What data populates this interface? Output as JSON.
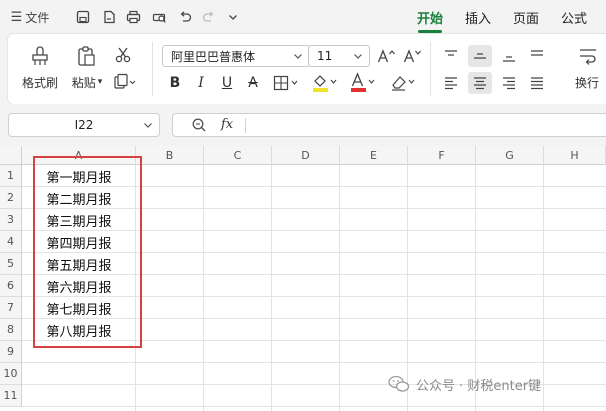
{
  "titlebar": {
    "file_menu": "文件"
  },
  "tabs": [
    {
      "label": "开始",
      "active": true
    },
    {
      "label": "插入",
      "active": false
    },
    {
      "label": "页面",
      "active": false
    },
    {
      "label": "公式",
      "active": false
    }
  ],
  "ribbon": {
    "format_painter": "格式刷",
    "paste": "粘贴",
    "font_name": "阿里巴巴普惠体",
    "font_size": "11",
    "wrap": "换行"
  },
  "formula": {
    "name_box": "I22",
    "fx_label": "fx",
    "value": ""
  },
  "sheet": {
    "columns": [
      "A",
      "B",
      "C",
      "D",
      "E",
      "F",
      "G",
      "H"
    ],
    "rows": [
      "1",
      "2",
      "3",
      "4",
      "5",
      "6",
      "7",
      "8",
      "9",
      "10",
      "11"
    ],
    "cells_A": [
      "第一期月报",
      "第二期月报",
      "第三期月报",
      "第四期月报",
      "第五期月报",
      "第六期月报",
      "第七期月报",
      "第八期月报"
    ]
  },
  "watermark": "公众号 · 财税enter键",
  "colors": {
    "accent": "#1a7f3c",
    "highlight_box": "#d94040",
    "fill_yellow": "#f1e32a",
    "font_red": "#e03030"
  }
}
